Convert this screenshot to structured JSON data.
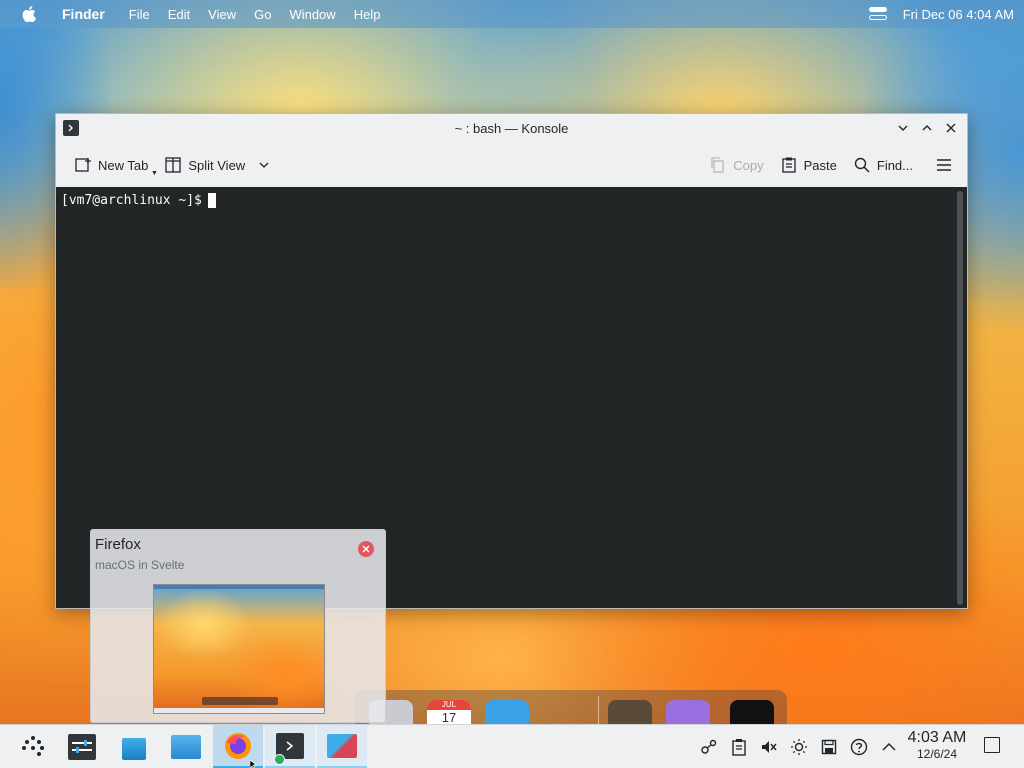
{
  "menubar": {
    "app_name": "Finder",
    "menus": [
      "File",
      "Edit",
      "View",
      "Go",
      "Window",
      "Help"
    ],
    "datetime": "Fri Dec 06  4:04 AM"
  },
  "window": {
    "title": "~ : bash — Konsole",
    "toolbar": {
      "new_tab": "New Tab",
      "split_view": "Split View",
      "copy": "Copy",
      "paste": "Paste",
      "find": "Find..."
    },
    "terminal": {
      "prompt": "[vm7@archlinux ~]$"
    }
  },
  "preview": {
    "title": "Firefox",
    "subtitle": "macOS in Svelte"
  },
  "dock": {
    "calendar_month": "JUL",
    "calendar_day": "17"
  },
  "panel": {
    "clock_time": "4:03 AM",
    "clock_date": "12/6/24"
  },
  "colors": {
    "accent": "#3daee9",
    "terminal_bg": "#232627",
    "close_red": "#e3555f"
  }
}
